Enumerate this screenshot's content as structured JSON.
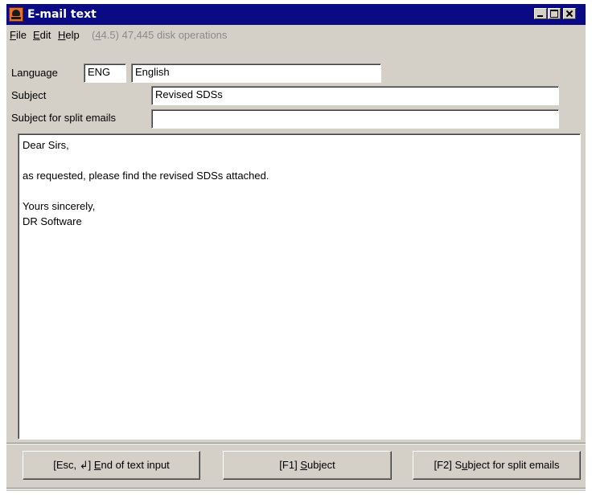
{
  "window": {
    "title": "E-mail text",
    "icon": "hazard-skull-icon"
  },
  "menu": {
    "file": {
      "mnemonic": "F",
      "rest": "ile"
    },
    "edit": {
      "mnemonic": "E",
      "rest": "dit"
    },
    "help": {
      "mnemonic": "H",
      "rest": "elp"
    },
    "status_prefix": "(",
    "status_mnemonic": "4",
    "status_rest": "4.5) 47,445 disk operations"
  },
  "form": {
    "language_label": "Language",
    "language_code": "ENG",
    "language_name": "English",
    "subject_label": "Subject",
    "subject_value": "Revised SDSs",
    "split_label": "Subject for split emails",
    "split_value": ""
  },
  "body": {
    "lines": [
      "Dear Sirs,",
      "",
      "as requested, please find the revised SDSs attached.",
      "",
      "Yours sincerely,",
      "DR Software"
    ]
  },
  "buttons": {
    "end": {
      "pre": "[Esc, ↲] ",
      "mnemonic": "E",
      "rest": "nd of text input"
    },
    "subject": {
      "pre": "[F1] ",
      "mnemonic": "S",
      "rest": "ubject"
    },
    "split": {
      "pre": "[F2] S",
      "mnemonic": "u",
      "rest": "bject for split emails"
    }
  },
  "colors": {
    "titlebar": "#0a0a84",
    "face": "#d4d0c8",
    "disabled_text": "#8a8a8a"
  }
}
